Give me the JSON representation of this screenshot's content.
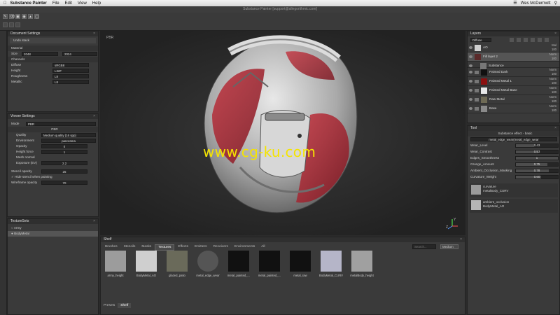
{
  "menubar": {
    "app": "Substance Painter",
    "items": [
      "File",
      "Edit",
      "View",
      "Help"
    ],
    "user": "Wes McDermott"
  },
  "window": {
    "title": "Substance Painter [support@allegorithmic.com]"
  },
  "doc": {
    "title": "Document Settings",
    "undo": "Undo stack",
    "material_label": "Material",
    "size_label": "Size",
    "size_val": "2048",
    "size_val2": "2024",
    "channels_label": "Channels",
    "channels": [
      {
        "name": "Diffuse",
        "fmt": "sRGB8"
      },
      {
        "name": "Height",
        "fmt": "L32F"
      },
      {
        "name": "Roughness",
        "fmt": "L8"
      },
      {
        "name": "Metallic",
        "fmt": "L8"
      }
    ]
  },
  "viewer": {
    "title": "Viewer Settings",
    "mode_label": "Mode",
    "mode": "PBR",
    "pbr_header": "PBR",
    "quality_label": "Quality",
    "quality": "Medium quality (16 spp)",
    "env_label": "Environment",
    "env": "panorama",
    "opacity_label": "Opacity",
    "opacity": "0",
    "hforce_label": "Height force",
    "hforce": "1",
    "mnormal_label": "Mesh normal",
    "exposure_label": "Exposure (EV)",
    "exposure": "2.2",
    "stencil_label": "Stencil opacity",
    "stencil": "25",
    "hide_stencil": "Hide stencil when painting",
    "wire_label": "Wireframe opacity",
    "wire": "70"
  },
  "texturesets": {
    "title": "TextureSets",
    "items": [
      "Army",
      "BodyMetal"
    ]
  },
  "viewport": {
    "label": "PBR",
    "watermark": "www.cg-ku.com",
    "axis_z": "Z",
    "axis_y": "Y"
  },
  "layers": {
    "title": "Layers",
    "channel": "Diffuse",
    "items": [
      {
        "name": "AO",
        "blend": "Mul",
        "op": "100",
        "color": "#cfcfcf"
      },
      {
        "name": "Fill layer 2",
        "blend": "Norm",
        "op": "100",
        "color": "#5a2a2a"
      },
      {
        "name": "Substance",
        "blend": "",
        "op": "",
        "color": "#777"
      },
      {
        "name": "Painted Dark",
        "blend": "Norm",
        "op": "100",
        "color": "#111"
      },
      {
        "name": "Painted Metal 1",
        "blend": "Norm",
        "op": "100",
        "color": "#8b1010"
      },
      {
        "name": "Painted Metal Base",
        "blend": "Norm",
        "op": "100",
        "color": "#e8e8e8"
      },
      {
        "name": "Raw Metal",
        "blend": "Norm",
        "op": "100",
        "color": "#6e6a55"
      },
      {
        "name": "Base",
        "blend": "Norm",
        "op": "100",
        "color": "#8a8a8a"
      }
    ]
  },
  "tool": {
    "title": "Tool",
    "effect": "Substance effect - basic",
    "preset": "metal_edge_wear(metal_edge_wear",
    "params": [
      {
        "name": "Wear_Level",
        "value": "0.43",
        "level": 0.43
      },
      {
        "name": "Wear_Contrast",
        "value": "0.53",
        "level": 0.53
      },
      {
        "name": "Edges_Smoothness",
        "value": "1",
        "level": 1.0
      },
      {
        "name": "Grunge_Amount",
        "value": "0.75",
        "level": 0.75
      },
      {
        "name": "Ambient_Occlusion_Masking",
        "value": "0.78",
        "level": 0.78
      },
      {
        "name": "Curvature_Weight",
        "value": "0.60",
        "level": 0.6
      }
    ],
    "inputs": [
      {
        "line1": "curvature",
        "line2": "metalBody_CURV"
      },
      {
        "line1": "ambient_occlusion",
        "line2": "BodyMetal_AO"
      }
    ]
  },
  "shelf": {
    "title": "Shelf",
    "tabs": [
      "Brushes",
      "Stencils",
      "Masks",
      "Textures",
      "Effects",
      "Emitters",
      "Receivers",
      "Environments",
      "All"
    ],
    "active_tab": "Textures",
    "search_placeholder": "Search...",
    "size": "Medium",
    "items": [
      "army_height",
      "BodyMetal_AO",
      "glazed_patio",
      "metal_edge_wear",
      "metal_painted_...",
      "metal_painted_...",
      "metal_raw",
      "BodyMetal_CURV",
      "metalBody_height"
    ],
    "bottom_tabs": [
      "Presets",
      "Shelf"
    ]
  },
  "colors": {
    "accent": "#f5e400",
    "panel": "#3a3a3a",
    "dark": "#2b2b2b"
  }
}
